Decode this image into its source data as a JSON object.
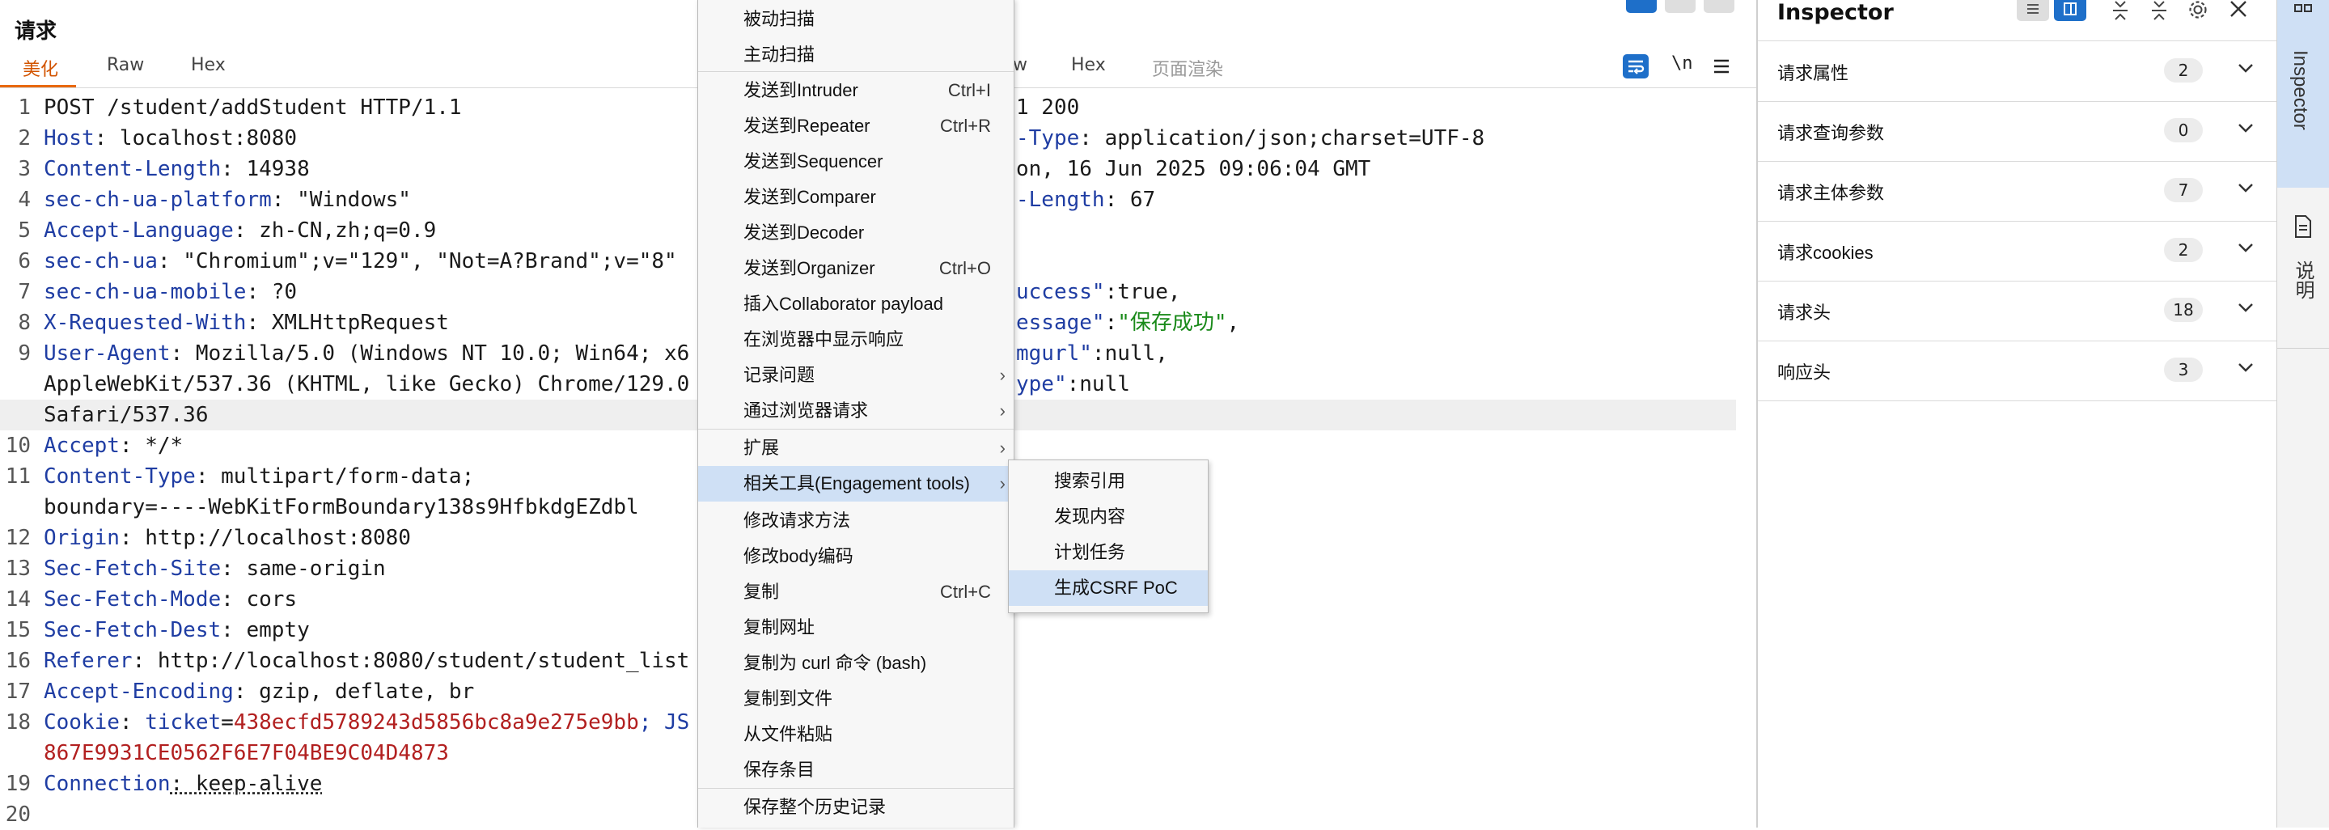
{
  "request": {
    "title": "请求",
    "tabs": [
      "美化",
      "Raw",
      "Hex"
    ],
    "lines": [
      {
        "n": "1",
        "segs": [
          {
            "t": "POST /student/addStudent HTTP/1.1",
            "c": "v"
          }
        ]
      },
      {
        "n": "2",
        "segs": [
          {
            "t": "Host",
            "c": "k"
          },
          {
            "t": ": localhost:8080",
            "c": "v"
          }
        ]
      },
      {
        "n": "3",
        "segs": [
          {
            "t": "Content-Length",
            "c": "k"
          },
          {
            "t": ": 14938",
            "c": "v"
          }
        ]
      },
      {
        "n": "4",
        "segs": [
          {
            "t": "sec-ch-ua-platform",
            "c": "k"
          },
          {
            "t": ": \"Windows\"",
            "c": "v"
          }
        ]
      },
      {
        "n": "5",
        "segs": [
          {
            "t": "Accept-Language",
            "c": "k"
          },
          {
            "t": ": zh-CN,zh;q=0.9",
            "c": "v"
          }
        ]
      },
      {
        "n": "6",
        "segs": [
          {
            "t": "sec-ch-ua",
            "c": "k"
          },
          {
            "t": ": \"Chromium\";v=\"129\", \"Not=A?Brand\";v=\"8\"",
            "c": "v"
          }
        ]
      },
      {
        "n": "7",
        "segs": [
          {
            "t": "sec-ch-ua-mobile",
            "c": "k"
          },
          {
            "t": ": ?0",
            "c": "v"
          }
        ]
      },
      {
        "n": "8",
        "segs": [
          {
            "t": "X-Requested-With",
            "c": "k"
          },
          {
            "t": ": XMLHttpRequest",
            "c": "v"
          }
        ]
      },
      {
        "n": "9",
        "segs": [
          {
            "t": "User-Agent",
            "c": "k"
          },
          {
            "t": ": Mozilla/5.0 (Windows NT 10.0; Win64; x6",
            "c": "v"
          }
        ]
      },
      {
        "n": "",
        "segs": [
          {
            "t": "AppleWebKit/537.36 (KHTML, like Gecko) Chrome/129.0",
            "c": "v"
          }
        ]
      },
      {
        "n": "",
        "segs": [
          {
            "t": "Safari/537.36",
            "c": "v"
          }
        ],
        "hl": true
      },
      {
        "n": "10",
        "segs": [
          {
            "t": "Accept",
            "c": "k"
          },
          {
            "t": ": */*",
            "c": "v"
          }
        ]
      },
      {
        "n": "11",
        "segs": [
          {
            "t": "Content-Type",
            "c": "k"
          },
          {
            "t": ": multipart/form-data;",
            "c": "v"
          }
        ]
      },
      {
        "n": "",
        "segs": [
          {
            "t": "boundary=----WebKitFormBoundary138s9HfbkdgEZdbl",
            "c": "v"
          }
        ]
      },
      {
        "n": "12",
        "segs": [
          {
            "t": "Origin",
            "c": "k"
          },
          {
            "t": ": http://localhost:8080",
            "c": "v"
          }
        ]
      },
      {
        "n": "13",
        "segs": [
          {
            "t": "Sec-Fetch-Site",
            "c": "k"
          },
          {
            "t": ": same-origin",
            "c": "v"
          }
        ]
      },
      {
        "n": "14",
        "segs": [
          {
            "t": "Sec-Fetch-Mode",
            "c": "k"
          },
          {
            "t": ": cors",
            "c": "v"
          }
        ]
      },
      {
        "n": "15",
        "segs": [
          {
            "t": "Sec-Fetch-Dest",
            "c": "k"
          },
          {
            "t": ": empty",
            "c": "v"
          }
        ]
      },
      {
        "n": "16",
        "segs": [
          {
            "t": "Referer",
            "c": "k"
          },
          {
            "t": ": http://localhost:8080/student/student_list",
            "c": "v"
          }
        ]
      },
      {
        "n": "17",
        "segs": [
          {
            "t": "Accept-Encoding",
            "c": "k"
          },
          {
            "t": ": gzip, deflate, br",
            "c": "v"
          }
        ]
      },
      {
        "n": "18",
        "segs": [
          {
            "t": "Cookie",
            "c": "k"
          },
          {
            "t": ": ",
            "c": "v"
          },
          {
            "t": "ticket",
            "c": "k"
          },
          {
            "t": "=",
            "c": "v"
          },
          {
            "t": "438ecfd5789243d5856bc8a9e275e9bb",
            "c": "red"
          },
          {
            "t": "; JS",
            "c": "k"
          }
        ]
      },
      {
        "n": "",
        "segs": [
          {
            "t": "867E9931CE0562F6E7F04BE9C04D4873",
            "c": "red"
          }
        ]
      },
      {
        "n": "19",
        "segs": [
          {
            "t": "Connection",
            "c": "k"
          },
          {
            "t": ": keep-alive",
            "c": "v"
          }
        ]
      },
      {
        "n": "20",
        "segs": []
      }
    ]
  },
  "response": {
    "tabs_visible": [
      "w",
      "Hex",
      "页面渲染"
    ],
    "wrap_button": "\\n",
    "lines": [
      {
        "segs": [
          {
            "t": "1 200",
            "c": "v"
          }
        ]
      },
      {
        "segs": [
          {
            "t": "-Type",
            "c": "k"
          },
          {
            "t": ": application/json;charset=UTF-8",
            "c": "v"
          }
        ]
      },
      {
        "segs": [
          {
            "t": "on, 16 Jun 2025 09:06:04 GMT",
            "c": "v"
          }
        ]
      },
      {
        "segs": [
          {
            "t": "-Length",
            "c": "k"
          },
          {
            "t": ": 67",
            "c": "v"
          }
        ]
      },
      {
        "segs": []
      },
      {
        "segs": []
      },
      {
        "segs": [
          {
            "t": "uccess\"",
            "c": "k"
          },
          {
            "t": ":true,",
            "c": "v"
          }
        ]
      },
      {
        "segs": [
          {
            "t": "essage\"",
            "c": "k"
          },
          {
            "t": ":",
            "c": "v"
          },
          {
            "t": "\"保存成功\"",
            "c": "str"
          },
          {
            "t": ",",
            "c": "v"
          }
        ]
      },
      {
        "segs": [
          {
            "t": "mgurl\"",
            "c": "k"
          },
          {
            "t": ":null,",
            "c": "v"
          }
        ]
      },
      {
        "segs": [
          {
            "t": "ype\"",
            "c": "k"
          },
          {
            "t": ":null",
            "c": "v"
          }
        ]
      }
    ]
  },
  "context_menu": {
    "items": [
      {
        "label": "被动扫描",
        "shortcut": ""
      },
      {
        "label": "主动扫描",
        "shortcut": ""
      },
      {
        "sep": true
      },
      {
        "label": "发送到Intruder",
        "shortcut": "Ctrl+I"
      },
      {
        "label": "发送到Repeater",
        "shortcut": "Ctrl+R"
      },
      {
        "label": "发送到Sequencer",
        "shortcut": ""
      },
      {
        "label": "发送到Comparer",
        "shortcut": ""
      },
      {
        "label": "发送到Decoder",
        "shortcut": ""
      },
      {
        "label": "发送到Organizer",
        "shortcut": "Ctrl+O"
      },
      {
        "label": "插入Collaborator payload",
        "shortcut": ""
      },
      {
        "label": "在浏览器中显示响应",
        "shortcut": ""
      },
      {
        "label": "记录问题",
        "shortcut": "",
        "submenu": true
      },
      {
        "label": "通过浏览器请求",
        "shortcut": "",
        "submenu": true
      },
      {
        "sep": true
      },
      {
        "label": "扩展",
        "shortcut": "",
        "submenu": true
      },
      {
        "label": "相关工具(Engagement tools)",
        "shortcut": "",
        "submenu": true,
        "active": true
      },
      {
        "label": "修改请求方法",
        "shortcut": ""
      },
      {
        "label": "修改body编码",
        "shortcut": ""
      },
      {
        "label": "复制",
        "shortcut": "Ctrl+C"
      },
      {
        "label": "复制网址",
        "shortcut": ""
      },
      {
        "label": "复制为 curl 命令 (bash)",
        "shortcut": ""
      },
      {
        "label": "复制到文件",
        "shortcut": ""
      },
      {
        "label": "从文件粘贴",
        "shortcut": ""
      },
      {
        "label": "保存条目",
        "shortcut": ""
      },
      {
        "sep": true
      },
      {
        "label": "保存整个历史记录",
        "shortcut": ""
      }
    ],
    "submenu": [
      {
        "label": "搜索引用"
      },
      {
        "label": "发现内容"
      },
      {
        "label": "计划任务"
      },
      {
        "label": "生成CSRF PoC",
        "active": true
      }
    ]
  },
  "inspector": {
    "title": "Inspector",
    "rows": [
      {
        "label": "请求属性",
        "count": "2"
      },
      {
        "label": "请求查询参数",
        "count": "0"
      },
      {
        "label": "请求主体参数",
        "count": "7"
      },
      {
        "label": "请求cookies",
        "count": "2"
      },
      {
        "label": "请求头",
        "count": "18"
      },
      {
        "label": "响应头",
        "count": "3"
      }
    ]
  },
  "side_tabs": [
    "Inspector",
    "说明"
  ],
  "colors": {
    "accent": "#e8680f",
    "brand_blue": "#1e6fc9",
    "highlight": "#cfe0f5"
  }
}
